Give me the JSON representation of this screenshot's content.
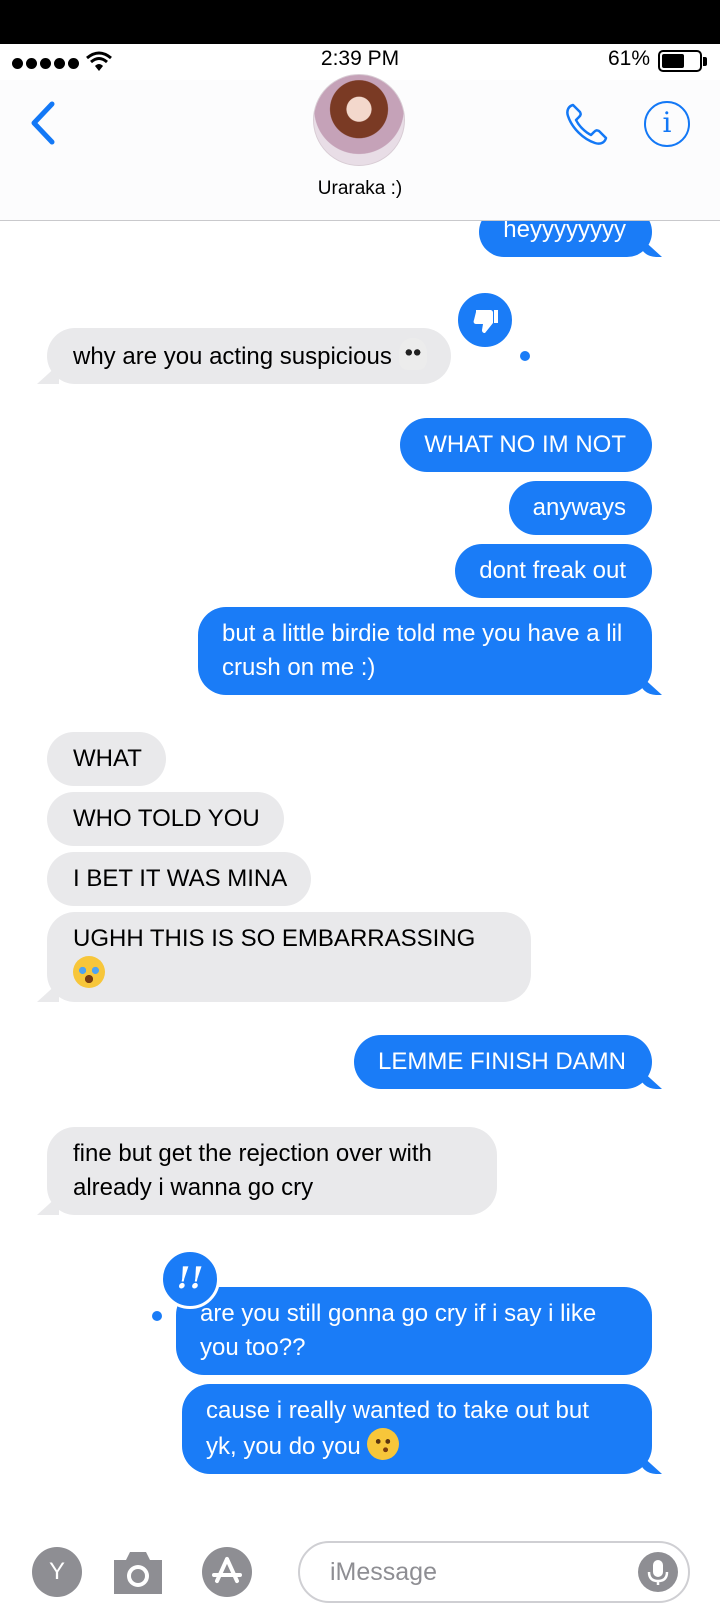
{
  "status_bar": {
    "time": "2:39 PM",
    "battery_percent": "61%",
    "battery_level": 0.61,
    "signal_bars": 5
  },
  "header": {
    "contact_name": "Uraraka :)",
    "back_icon": "chevron-left-icon",
    "phone_icon": "phone-icon",
    "info_icon": "info-icon",
    "info_glyph": "i"
  },
  "messages": [
    {
      "direction": "outgoing",
      "text": "heyyyyyyyy"
    },
    {
      "direction": "incoming",
      "text": "why are you acting suspicious",
      "emoji": "skull",
      "tapback": "thumbs-down"
    },
    {
      "direction": "outgoing",
      "text": "WHAT NO IM NOT"
    },
    {
      "direction": "outgoing",
      "text": "anyways"
    },
    {
      "direction": "outgoing",
      "text": "dont freak out"
    },
    {
      "direction": "outgoing",
      "text": "but a little birdie told me you have a lil crush on me :)"
    },
    {
      "direction": "incoming",
      "text": "WHAT"
    },
    {
      "direction": "incoming",
      "text": "WHO TOLD YOU"
    },
    {
      "direction": "incoming",
      "text": "I BET IT WAS MINA"
    },
    {
      "direction": "incoming",
      "text": "UGHH THIS IS SO EMBARRASSING",
      "emoji": "loudly-crying-face"
    },
    {
      "direction": "outgoing",
      "text": "LEMME FINISH DAMN"
    },
    {
      "direction": "incoming",
      "text": "fine but get the rejection over with already i wanna go cry"
    },
    {
      "direction": "outgoing",
      "text": "are you still gonna go cry if i say i like you too??",
      "tapback": "!!"
    },
    {
      "direction": "outgoing",
      "text": "cause i really wanted to take out but yk, you do you",
      "emoji": "kissing-face"
    }
  ],
  "input_bar": {
    "app_button_label": "Y",
    "placeholder": "iMessage",
    "camera_icon": "camera-icon",
    "appstore_icon": "app-store-icon",
    "mic_icon": "microphone-icon"
  },
  "colors": {
    "outgoing_bubble": "#1a7cf7",
    "incoming_bubble": "#e9e9eb",
    "accent": "#1378f6"
  }
}
